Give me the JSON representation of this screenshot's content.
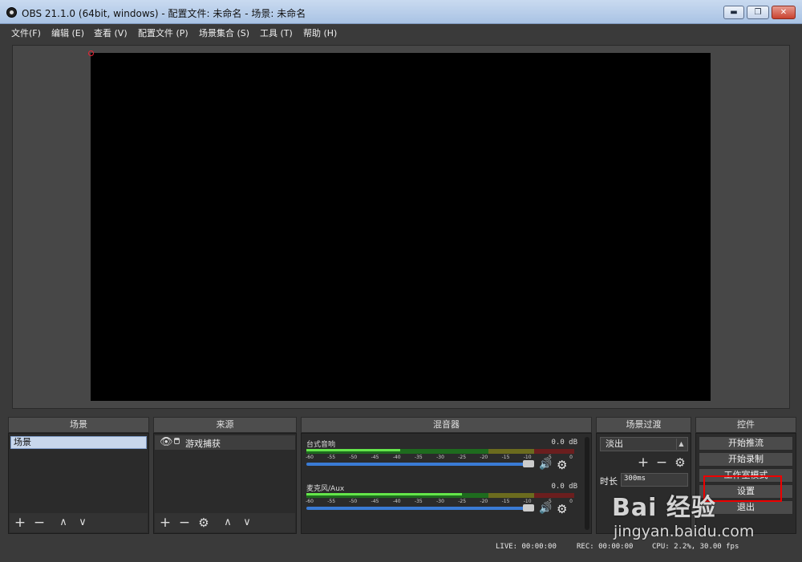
{
  "window": {
    "title": "OBS 21.1.0 (64bit, windows) - 配置文件: 未命名 - 场景: 未命名",
    "minimize": "▬",
    "maximize": "❐",
    "close": "✕"
  },
  "menu": [
    "文件(F)",
    "编辑 (E)",
    "查看 (V)",
    "配置文件 (P)",
    "场景集合 (S)",
    "工具 (T)",
    "帮助 (H)"
  ],
  "docks": {
    "scenes": {
      "header": "场景",
      "items": [
        "场景"
      ]
    },
    "sources": {
      "header": "来源",
      "items": [
        {
          "name": "游戏捕获",
          "visible_icon": "eye-icon",
          "lock_icon": "lock-icon"
        }
      ]
    },
    "mixer": {
      "header": "混音器",
      "channels": [
        {
          "name": "台式音响",
          "db": "0.0 dB",
          "level": 0.35
        },
        {
          "name": "麦克风/Aux",
          "db": "0.0 dB",
          "level": 0.58
        }
      ],
      "scale": [
        "-60",
        "-55",
        "-50",
        "-45",
        "-40",
        "-35",
        "-30",
        "-25",
        "-20",
        "-15",
        "-10",
        "-5",
        "0"
      ]
    },
    "transitions": {
      "header": "场景过渡",
      "selected": "淡出",
      "duration_label": "时长",
      "duration_value": "300ms"
    },
    "controls": {
      "header": "控件",
      "buttons": [
        "开始推流",
        "开始录制",
        "工作室模式",
        "设置",
        "退出"
      ]
    }
  },
  "toolbar_glyphs": {
    "add": "+",
    "remove": "−",
    "up": "∧",
    "down": "∨",
    "gear": "⚙",
    "speaker": "🔊"
  },
  "status": {
    "live": "LIVE: 00:00:00",
    "rec": "REC: 00:00:00",
    "cpu": "CPU: 2.2%, 30.00 fps"
  },
  "watermark": {
    "logo": "Bai 经验",
    "url": "jingyan.baidu.com"
  },
  "colors": {
    "window_bg": "#3a3a3a",
    "panel_bg": "#2b2b2b",
    "accent_blue": "#3a7bd5",
    "meter_green": "#64e64a",
    "highlight_red": "#e00000"
  }
}
